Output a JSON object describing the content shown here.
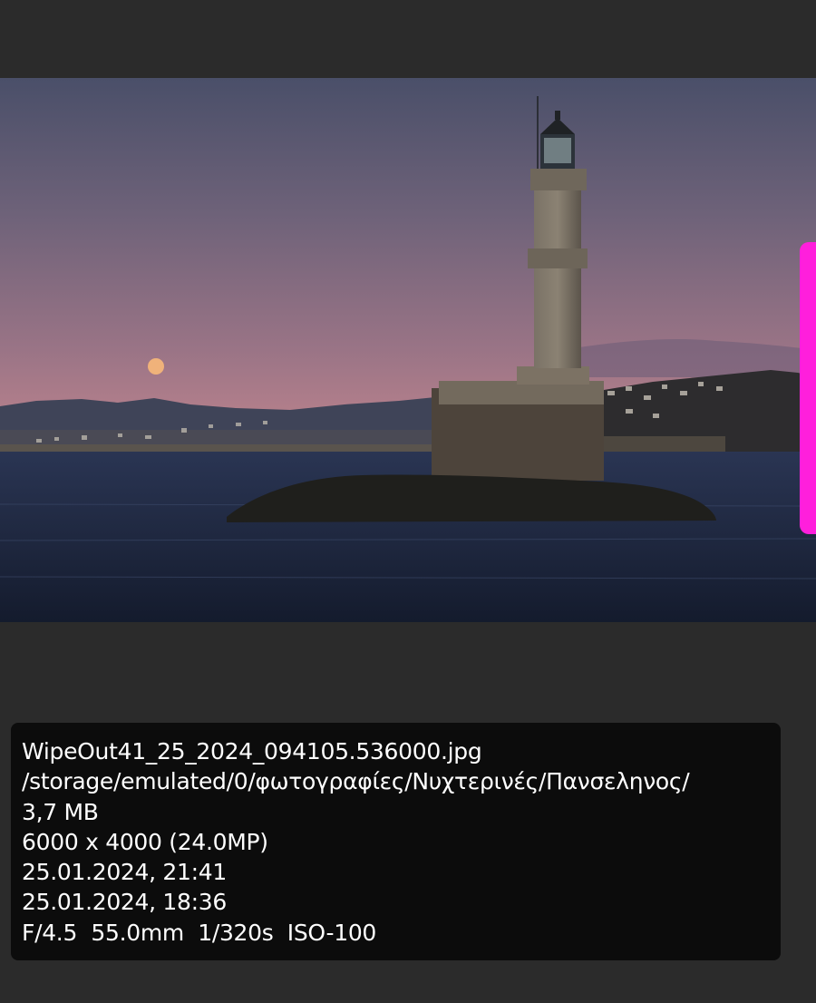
{
  "photo": {
    "icon": "photo-lighthouse-moon"
  },
  "scrollbar": {
    "color": "#ff1fdc"
  },
  "info": {
    "filename": "WipeOut41_25_2024_094105.536000.jpg",
    "path": "/storage/emulated/0/φωτογραφίες/Νυχτερινές/Πανσεληνος/",
    "size": "3,7 MB",
    "resolution": "6000 x 4000 (24.0MP)",
    "date_modified": "25.01.2024, 21:41",
    "date_taken": "25.01.2024, 18:36",
    "exif": "F/4.5  55.0mm  1/320s  ISO-100"
  }
}
